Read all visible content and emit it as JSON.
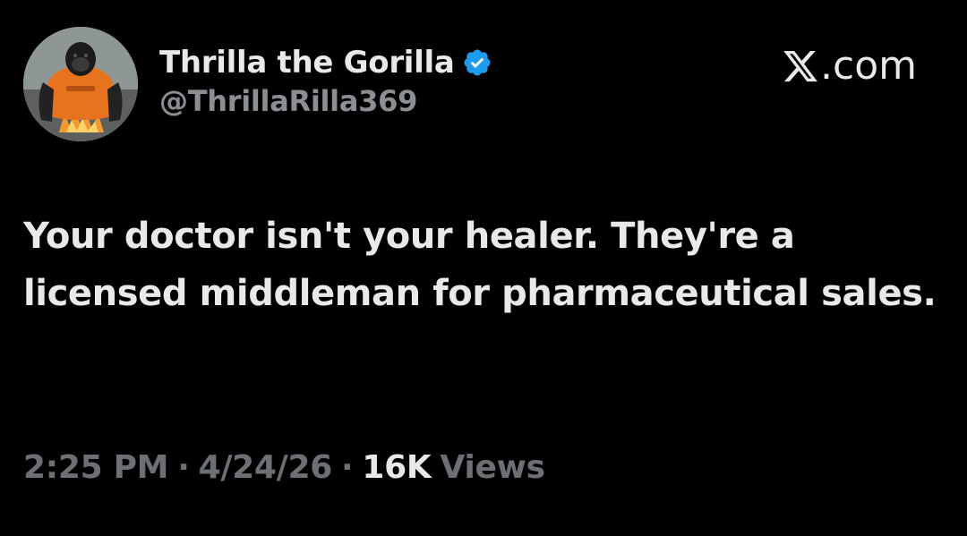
{
  "user": {
    "display_name": "Thrilla the Gorilla",
    "handle": "@ThrillaRilla369",
    "verified": true,
    "avatar_icon": "gorilla-avatar"
  },
  "brand": {
    "label_suffix": ".com",
    "icon": "x-logo-icon"
  },
  "tweet": {
    "text": "Your doctor isn't your healer. They're a licensed middleman for pharmaceutical sales."
  },
  "meta": {
    "time": "2:25 PM",
    "separator": "·",
    "date": "4/24/26",
    "views_count": "16K",
    "views_label": "Views"
  },
  "colors": {
    "background": "#000000",
    "text_primary": "#e7e9ea",
    "text_secondary": "#8b8f94",
    "verified_badge": "#1d9bf0"
  }
}
